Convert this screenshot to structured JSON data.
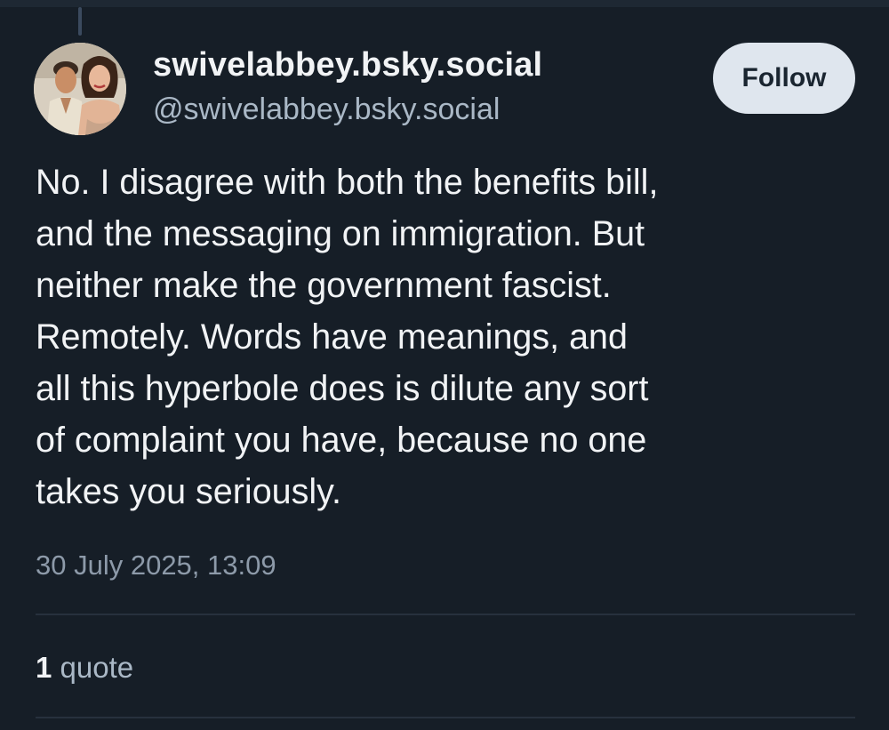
{
  "post": {
    "author": {
      "display_name": "swivelabbey.bsky.social",
      "handle": "@swivelabbey.bsky.social",
      "avatar_icon": "user-avatar-photo"
    },
    "follow_label": "Follow",
    "text": "No. I disagree with both the benefits bill,\nand the messaging on immigration. But\nneither make the government fascist.\nRemotely. Words have meanings, and\nall this hyperbole does is dilute any sort\nof complaint you have, because no one\ntakes you seriously.",
    "timestamp": "30 July 2025, 13:09",
    "stats": {
      "quote_count": "1",
      "quote_label": "quote"
    }
  },
  "theme": {
    "background": "#161e27",
    "text": "#f1f3f5",
    "muted_text": "#aab8c6",
    "timestamp_text": "#8d9aa9",
    "follow_button_bg": "#dfe6ee",
    "divider": "#27313d"
  }
}
